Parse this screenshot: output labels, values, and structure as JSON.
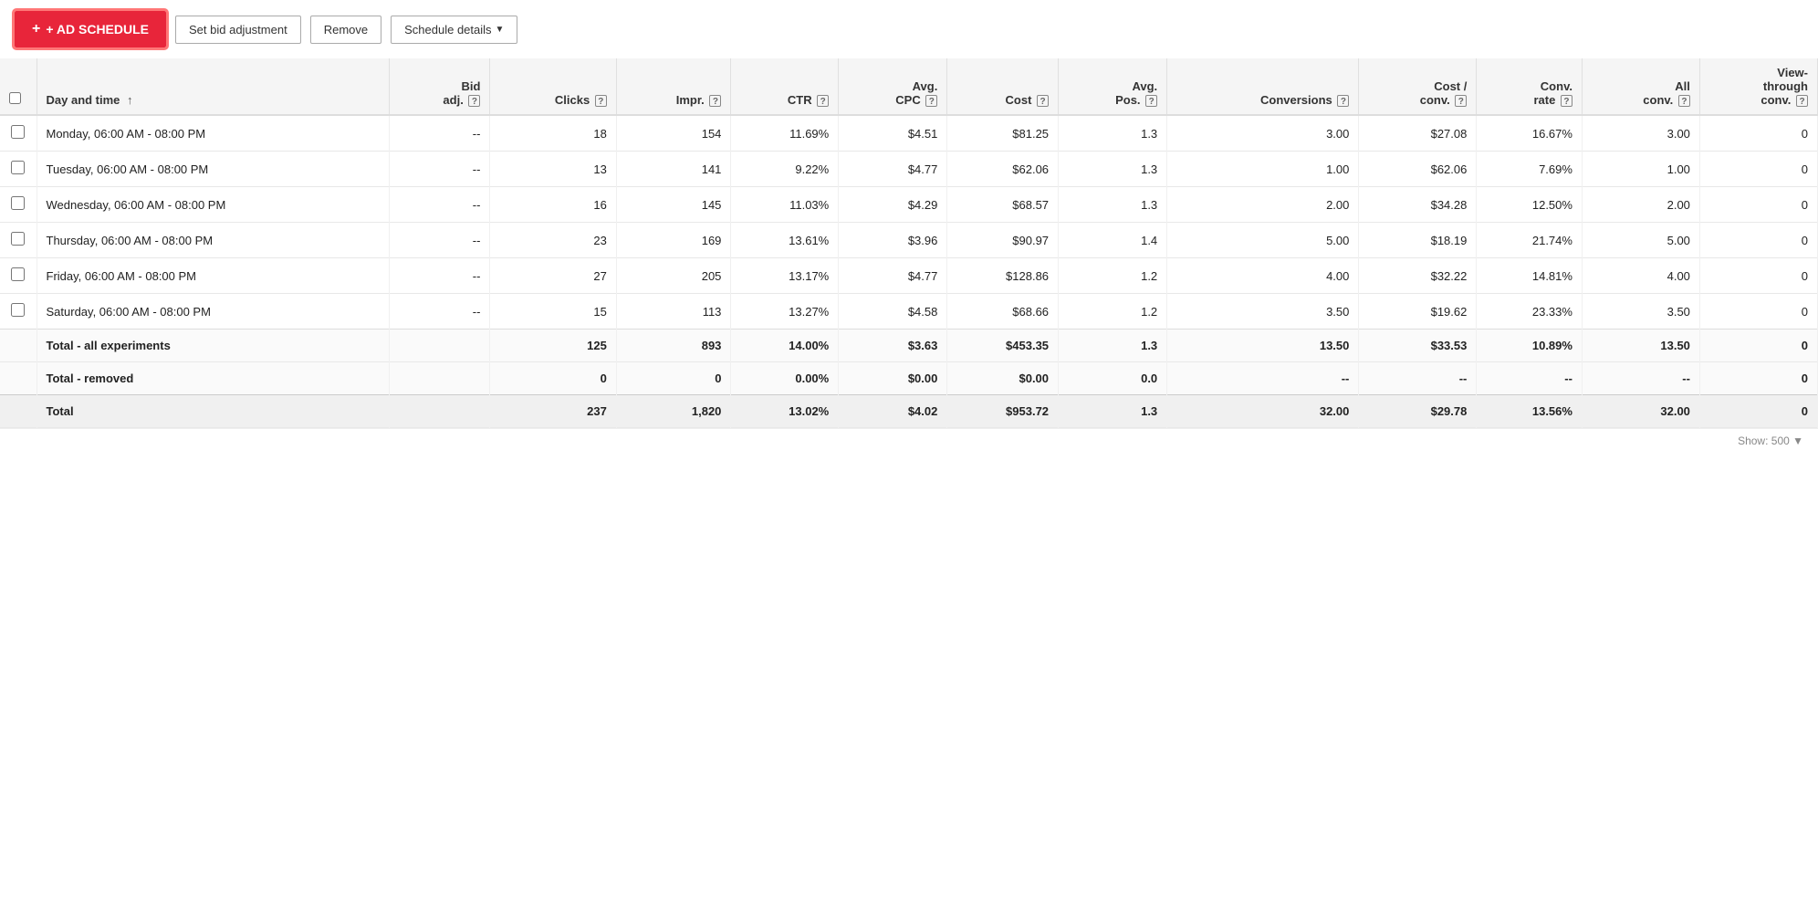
{
  "toolbar": {
    "add_schedule_label": "+ AD SCHEDULE",
    "set_bid_label": "Set bid adjustment",
    "remove_label": "Remove",
    "schedule_details_label": "Schedule details"
  },
  "table": {
    "columns": [
      {
        "key": "checkbox",
        "label": "",
        "help": false
      },
      {
        "key": "day_time",
        "label": "Day and time",
        "help": false,
        "sort": true
      },
      {
        "key": "bid_adj",
        "label": "Bid adj.",
        "help": true
      },
      {
        "key": "clicks",
        "label": "Clicks",
        "help": true
      },
      {
        "key": "impr",
        "label": "Impr.",
        "help": true
      },
      {
        "key": "ctr",
        "label": "CTR",
        "help": true
      },
      {
        "key": "avg_cpc",
        "label": "Avg. CPC",
        "help": true,
        "multiline": false
      },
      {
        "key": "cost",
        "label": "Cost",
        "help": true
      },
      {
        "key": "avg_pos",
        "label": "Avg. Pos.",
        "help": true,
        "multiline": false
      },
      {
        "key": "conversions",
        "label": "Conversions",
        "help": true
      },
      {
        "key": "cost_conv",
        "label": "Cost / conv.",
        "help": true
      },
      {
        "key": "conv_rate",
        "label": "Conv. rate",
        "help": true
      },
      {
        "key": "all_conv",
        "label": "All conv.",
        "help": true
      },
      {
        "key": "view_through_conv",
        "label": "View-through conv.",
        "help": true
      }
    ],
    "rows": [
      {
        "day_time": "Monday, 06:00 AM - 08:00 PM",
        "bid_adj": "--",
        "clicks": "18",
        "impr": "154",
        "ctr": "11.69%",
        "avg_cpc": "$4.51",
        "cost": "$81.25",
        "avg_pos": "1.3",
        "conversions": "3.00",
        "cost_conv": "$27.08",
        "conv_rate": "16.67%",
        "all_conv": "3.00",
        "view_through_conv": "0"
      },
      {
        "day_time": "Tuesday, 06:00 AM - 08:00 PM",
        "bid_adj": "--",
        "clicks": "13",
        "impr": "141",
        "ctr": "9.22%",
        "avg_cpc": "$4.77",
        "cost": "$62.06",
        "avg_pos": "1.3",
        "conversions": "1.00",
        "cost_conv": "$62.06",
        "conv_rate": "7.69%",
        "all_conv": "1.00",
        "view_through_conv": "0"
      },
      {
        "day_time": "Wednesday, 06:00 AM - 08:00 PM",
        "bid_adj": "--",
        "clicks": "16",
        "impr": "145",
        "ctr": "11.03%",
        "avg_cpc": "$4.29",
        "cost": "$68.57",
        "avg_pos": "1.3",
        "conversions": "2.00",
        "cost_conv": "$34.28",
        "conv_rate": "12.50%",
        "all_conv": "2.00",
        "view_through_conv": "0"
      },
      {
        "day_time": "Thursday, 06:00 AM - 08:00 PM",
        "bid_adj": "--",
        "clicks": "23",
        "impr": "169",
        "ctr": "13.61%",
        "avg_cpc": "$3.96",
        "cost": "$90.97",
        "avg_pos": "1.4",
        "conversions": "5.00",
        "cost_conv": "$18.19",
        "conv_rate": "21.74%",
        "all_conv": "5.00",
        "view_through_conv": "0"
      },
      {
        "day_time": "Friday, 06:00 AM - 08:00 PM",
        "bid_adj": "--",
        "clicks": "27",
        "impr": "205",
        "ctr": "13.17%",
        "avg_cpc": "$4.77",
        "cost": "$128.86",
        "avg_pos": "1.2",
        "conversions": "4.00",
        "cost_conv": "$32.22",
        "conv_rate": "14.81%",
        "all_conv": "4.00",
        "view_through_conv": "0"
      },
      {
        "day_time": "Saturday, 06:00 AM - 08:00 PM",
        "bid_adj": "--",
        "clicks": "15",
        "impr": "113",
        "ctr": "13.27%",
        "avg_cpc": "$4.58",
        "cost": "$68.66",
        "avg_pos": "1.2",
        "conversions": "3.50",
        "cost_conv": "$19.62",
        "conv_rate": "23.33%",
        "all_conv": "3.50",
        "view_through_conv": "0"
      }
    ],
    "total_experiments": {
      "label": "Total - all experiments",
      "clicks": "125",
      "impr": "893",
      "ctr": "14.00%",
      "avg_cpc": "$3.63",
      "cost": "$453.35",
      "avg_pos": "1.3",
      "conversions": "13.50",
      "cost_conv": "$33.53",
      "conv_rate": "10.89%",
      "all_conv": "13.50",
      "view_through_conv": "0"
    },
    "total_removed": {
      "label": "Total - removed",
      "clicks": "0",
      "impr": "0",
      "ctr": "0.00%",
      "avg_cpc": "$0.00",
      "cost": "$0.00",
      "avg_pos": "0.0",
      "conversions": "--",
      "cost_conv": "--",
      "conv_rate": "--",
      "all_conv": "--",
      "view_through_conv": "0"
    },
    "total": {
      "label": "Total",
      "clicks": "237",
      "impr": "1,820",
      "ctr": "13.02%",
      "avg_cpc": "$4.02",
      "cost": "$953.72",
      "avg_pos": "1.3",
      "conversions": "32.00",
      "cost_conv": "$29.78",
      "conv_rate": "13.56%",
      "all_conv": "32.00",
      "view_through_conv": "0"
    }
  },
  "scrollbar_hint": "Show: 500"
}
